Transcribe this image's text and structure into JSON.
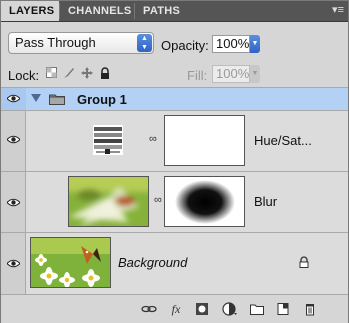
{
  "tabs": [
    {
      "label": "LAYERS"
    },
    {
      "label": "CHANNELS"
    },
    {
      "label": "PATHS"
    }
  ],
  "panel_menu_icon": "panel-menu-icon",
  "blend_mode": {
    "value": "Pass Through"
  },
  "opacity": {
    "label": "Opacity:",
    "value": "100%"
  },
  "lock": {
    "label": "Lock:"
  },
  "fill": {
    "label": "Fill:",
    "value": "100%"
  },
  "layers": [
    {
      "name": "Group 1",
      "type": "group",
      "selected": true
    },
    {
      "name": "Hue/Sat...",
      "type": "adjustment"
    },
    {
      "name": "Blur",
      "type": "pixel"
    },
    {
      "name": "Background",
      "type": "background",
      "locked": true
    }
  ],
  "colors": {
    "selection": "#b3d0f5",
    "accent": "#2f63c3"
  }
}
